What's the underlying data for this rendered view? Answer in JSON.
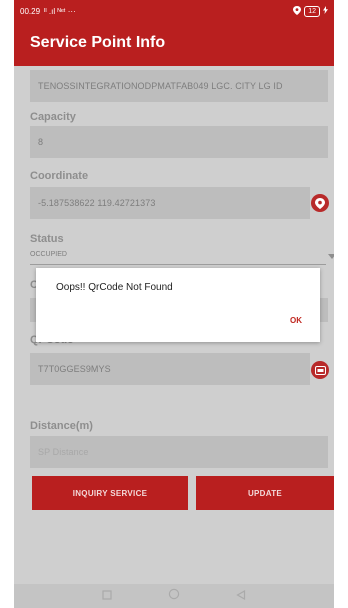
{
  "status_bar": {
    "time": "00.29",
    "indicators": "ᴵᴵ .ıl ᴺᵉᵗ ···",
    "battery": "12"
  },
  "app": {
    "title": "Service Point Info"
  },
  "fields": {
    "name_value": "TENOSSINTEGRATIONODPMATFAB049 LGC. CITY LG ID",
    "capacity_label": "Capacity",
    "capacity_value": "8",
    "coordinate_label": "Coordinate",
    "coordinate_value": "-5.187538622 119.42721373",
    "status_label": "Status",
    "status_value": "OCCUPIED",
    "partial_label": "C",
    "qr_label": "Qr Code",
    "qr_value": "T7T0GGES9MYS",
    "distance_label": "Distance(m)",
    "distance_placeholder": "SP Distance"
  },
  "dialog": {
    "message": "Oops!! QrCode Not Found",
    "ok_label": "OK"
  },
  "buttons": {
    "inquiry": "INQUIRY SERVICE",
    "update": "UPDATE"
  },
  "icons": {
    "location": "location-pin-icon",
    "scan": "qr-scan-icon",
    "square": "recent-apps-icon",
    "circle": "home-icon",
    "triangle": "back-icon"
  },
  "colors": {
    "primary": "#b91f1f",
    "accent_icon": "#b82a2a",
    "background": "#cfcfcf",
    "field": "#bdbdbd"
  }
}
